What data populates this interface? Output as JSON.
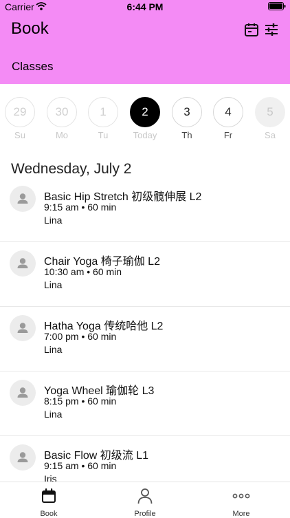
{
  "status_bar": {
    "carrier": "Carrier",
    "time": "6:44 PM"
  },
  "header": {
    "title": "Book",
    "subtitle": "Classes",
    "icons": [
      "calendar-icon",
      "sliders-icon"
    ]
  },
  "days": [
    {
      "number": "29",
      "label": "Su",
      "state": "past"
    },
    {
      "number": "30",
      "label": "Mo",
      "state": "past"
    },
    {
      "number": "1",
      "label": "Tu",
      "state": "past"
    },
    {
      "number": "2",
      "label": "Today",
      "state": "selected"
    },
    {
      "number": "3",
      "label": "Th",
      "state": "future"
    },
    {
      "number": "4",
      "label": "Fr",
      "state": "future"
    },
    {
      "number": "5",
      "label": "Sa",
      "state": "dim"
    }
  ],
  "date_heading": "Wednesday, July 2",
  "classes": [
    {
      "name": "Basic Hip Stretch 初级髋伸展 L2",
      "time": "9:15 am • 60 min",
      "instructor": "Lina"
    },
    {
      "name": "Chair Yoga 椅子瑜伽 L2",
      "time": "10:30 am • 60 min",
      "instructor": "Lina"
    },
    {
      "name": "Hatha Yoga 传统哈他 L2",
      "time": "7:00 pm • 60 min",
      "instructor": "Lina"
    },
    {
      "name": "Yoga Wheel 瑜伽轮 L3",
      "time": "8:15 pm • 60 min",
      "instructor": "Lina"
    },
    {
      "name": "Basic Flow 初级流 L1",
      "time": "9:15 am • 60 min",
      "instructor": "Iris"
    }
  ],
  "tabs": [
    {
      "label": "Book",
      "icon": "calendar-icon"
    },
    {
      "label": "Profile",
      "icon": "person-icon"
    },
    {
      "label": "More",
      "icon": "more-dots-icon"
    }
  ],
  "colors": {
    "header_bg": "#f48bf5",
    "selected_day": "#000000"
  }
}
